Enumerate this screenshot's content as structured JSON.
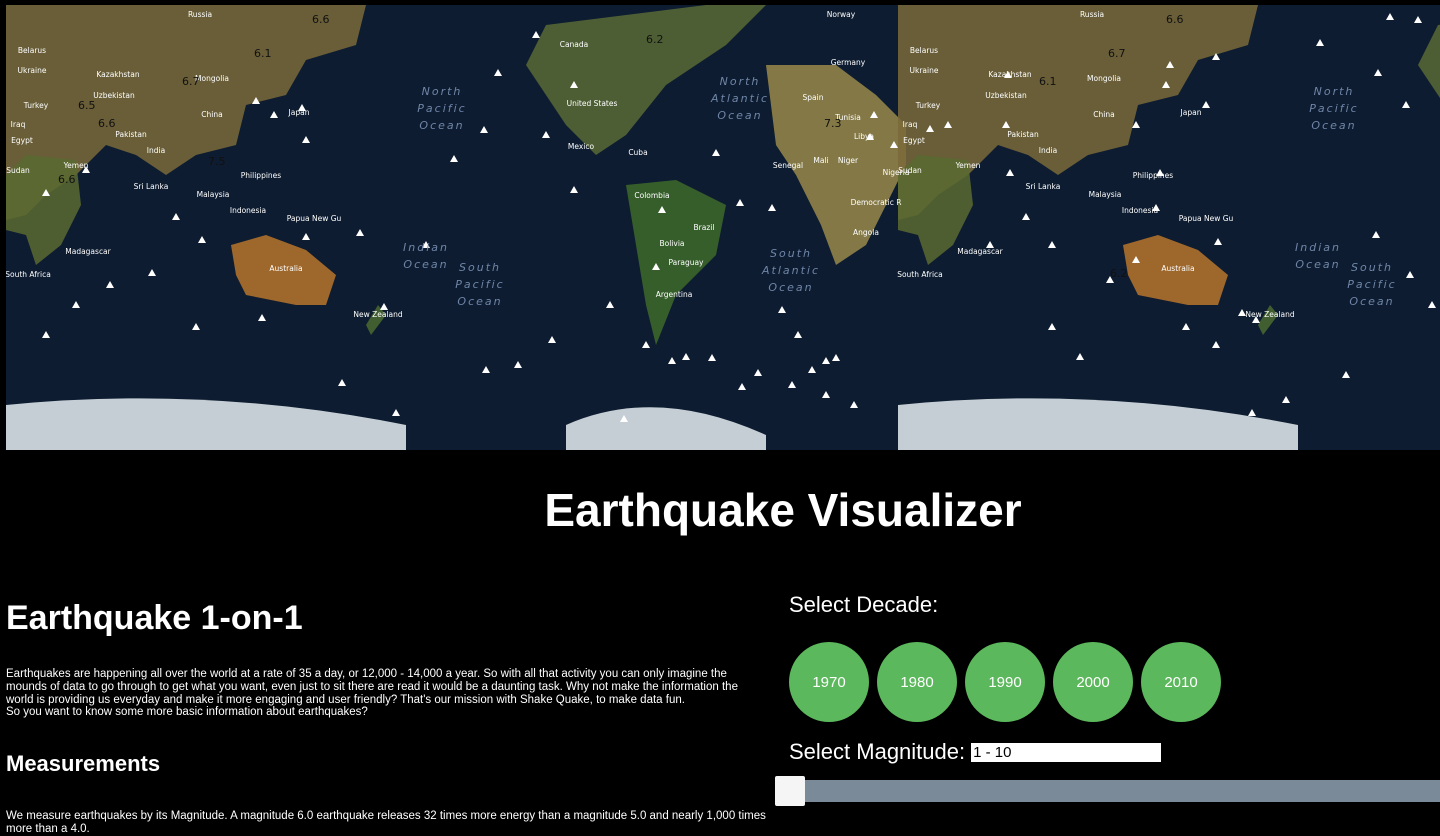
{
  "map": {
    "ocean_labels": [
      {
        "text": "North Pacific Ocean"
      },
      {
        "text": "North Atlantic Ocean"
      },
      {
        "text": "Indian Ocean"
      },
      {
        "text": "South Pacific Ocean"
      },
      {
        "text": "South Atlantic Ocean"
      }
    ],
    "country_labels": [
      "Russia",
      "Norway",
      "Canada",
      "Belarus",
      "Ukraine",
      "Kazakhstan",
      "Mongolia",
      "Uzbekistan",
      "Turkey",
      "Iraq",
      "Egypt",
      "Pakistan",
      "China",
      "Japan",
      "India",
      "Sudan",
      "Yemen",
      "Sri Lanka",
      "Philippines",
      "Malaysia",
      "Indonesia",
      "Papua New Guinea",
      "Madagascar",
      "Australia",
      "New Zealand",
      "South Africa",
      "United States",
      "Mexico",
      "Cuba",
      "Colombia",
      "Brazil",
      "Bolivia",
      "Paraguay",
      "Argentina",
      "Germany",
      "Spain",
      "Tunisia",
      "Libya",
      "Mali",
      "Niger",
      "Senegal",
      "Nigeria",
      "Angola",
      "Democratic Republic of the Congo"
    ],
    "magnitudes": [
      "6.6",
      "6.1",
      "6.7",
      "6.5",
      "6.6",
      "7.5",
      "6.2",
      "6.6",
      "7.3",
      "6.6",
      "6.7",
      "6.1",
      "6.2"
    ]
  },
  "colors": {
    "decade_button": "#5cb85c",
    "slider_track": "#7a8a99",
    "background": "#000000"
  },
  "page": {
    "title": "Earthquake Visualizer"
  },
  "left": {
    "heading": "Earthquake 1-on-1",
    "intro_1": "Earthquakes are happening all over the world at a rate of 35 a day, or 12,000 - 14,000 a year. So with all that activity you can only imagine the mounds of data to go through to get what you want, even just to sit there are read it would be a daunting task. Why not make the information the world is providing us everyday and make it more engaging and user friendly? That's our mission with Shake Quake, to make data fun.",
    "intro_2": "So you want to know some more basic information about earthquakes?",
    "measurements_heading": "Measurements",
    "measurements_text": "We measure earthquakes by its Magnitude. A magnitude 6.0 earthquake releases 32 times more energy than a magnitude 5.0 and nearly 1,000 times more than a 4.0."
  },
  "right": {
    "decade_label": "Select Decade:",
    "decades": [
      "1970",
      "1980",
      "1990",
      "2000",
      "2010"
    ],
    "magnitude_label": "Select Magnitude:",
    "magnitude_value": "1 - 10",
    "slider_value": 0
  }
}
